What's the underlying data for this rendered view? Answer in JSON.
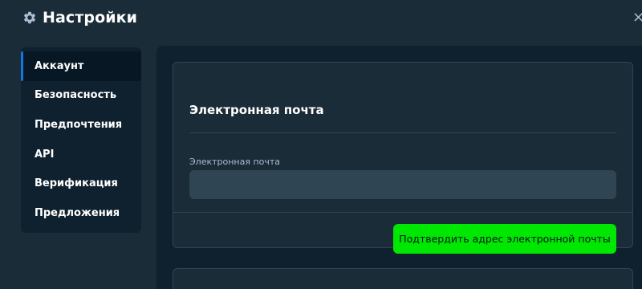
{
  "colors": {
    "page_bg": "#1a2c38",
    "panel_bg": "#0f212e",
    "input_bg": "#2f4553",
    "accent_green": "#00e701",
    "active_indicator": "#1475e1"
  },
  "header": {
    "icon": "gear-icon",
    "title": "Настройки",
    "close_icon": "close-icon",
    "close_glyph": "×"
  },
  "sidebar": {
    "items": [
      {
        "label": "Аккаунт",
        "active": true
      },
      {
        "label": "Безопасность",
        "active": false
      },
      {
        "label": "Предпочтения",
        "active": false
      },
      {
        "label": "API",
        "active": false
      },
      {
        "label": "Верификация",
        "active": false
      },
      {
        "label": "Предложения",
        "active": false
      }
    ]
  },
  "email_section": {
    "title": "Электронная почта",
    "field_label": "Электронная почта",
    "field_value": "",
    "field_placeholder": "",
    "confirm_button": "Подтвердить адрес электронной почты"
  }
}
